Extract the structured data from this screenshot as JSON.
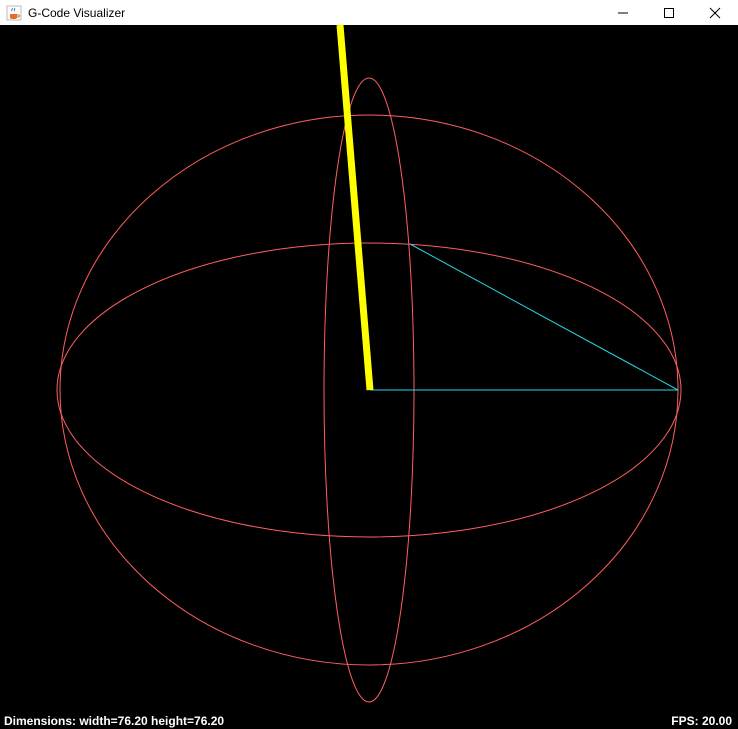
{
  "window": {
    "title": "G-Code Visualizer",
    "app_icon": "java-coffee-cup-icon",
    "controls": [
      "minimize-icon",
      "maximize-icon",
      "close-icon"
    ]
  },
  "status": {
    "dimensions": "Dimensions: width=76.20 height=76.20",
    "fps": "FPS: 20.00"
  },
  "colors": {
    "background": "#000000",
    "sphere": "#ff5f5f",
    "tool": "#ffff00",
    "path": "#27d6e6",
    "text": "#ffffff"
  }
}
